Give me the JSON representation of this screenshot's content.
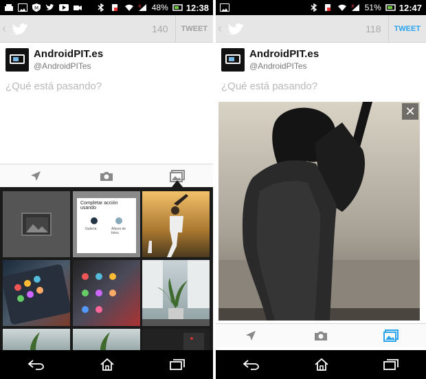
{
  "left_screen": {
    "status": {
      "battery": "48%",
      "time": "12:38"
    },
    "char_count": "140",
    "tweet_label": "TWEET",
    "account": {
      "name": "AndroidPIT.es",
      "handle": "@AndroidPITes"
    },
    "compose_placeholder": "¿Qué está pasando?",
    "gallery": {
      "dialog_title": "Completar acción usando",
      "dialog_option_1": "Galería",
      "dialog_option_2": "Álbum de fotos"
    }
  },
  "right_screen": {
    "status": {
      "battery": "51%",
      "time": "12:47"
    },
    "char_count": "118",
    "tweet_label": "TWEET",
    "account": {
      "name": "AndroidPIT.es",
      "handle": "@AndroidPITes"
    },
    "compose_placeholder": "¿Qué está pasando?"
  },
  "colors": {
    "accent": "#2aa3ef",
    "actionbar": "#e6e6e6",
    "statusbar": "#000000"
  }
}
